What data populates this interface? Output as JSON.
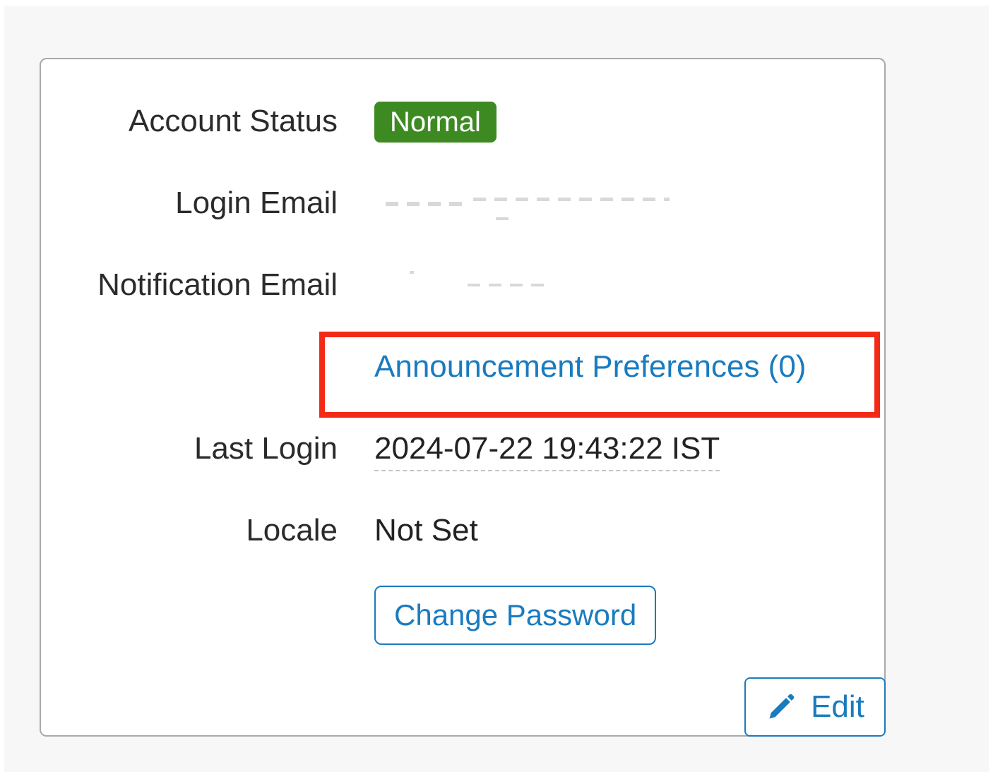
{
  "account_panel": {
    "status": {
      "label": "Account Status",
      "value": "Normal",
      "badge_color": "#3e8a22"
    },
    "login_email": {
      "label": "Login Email"
    },
    "notification_email": {
      "label": "Notification Email"
    },
    "announcement_link": {
      "label": "Announcement Preferences (0)",
      "highlight_color": "#f32b16"
    },
    "last_login": {
      "label": "Last Login",
      "value": "2024-07-22 19:43:22 IST"
    },
    "locale": {
      "label": "Locale",
      "value": "Not Set"
    },
    "change_password_button": {
      "label": "Change Password"
    },
    "edit_button": {
      "label": "Edit",
      "icon": "pencil-icon"
    },
    "accent_color": "#1a7bbf"
  }
}
